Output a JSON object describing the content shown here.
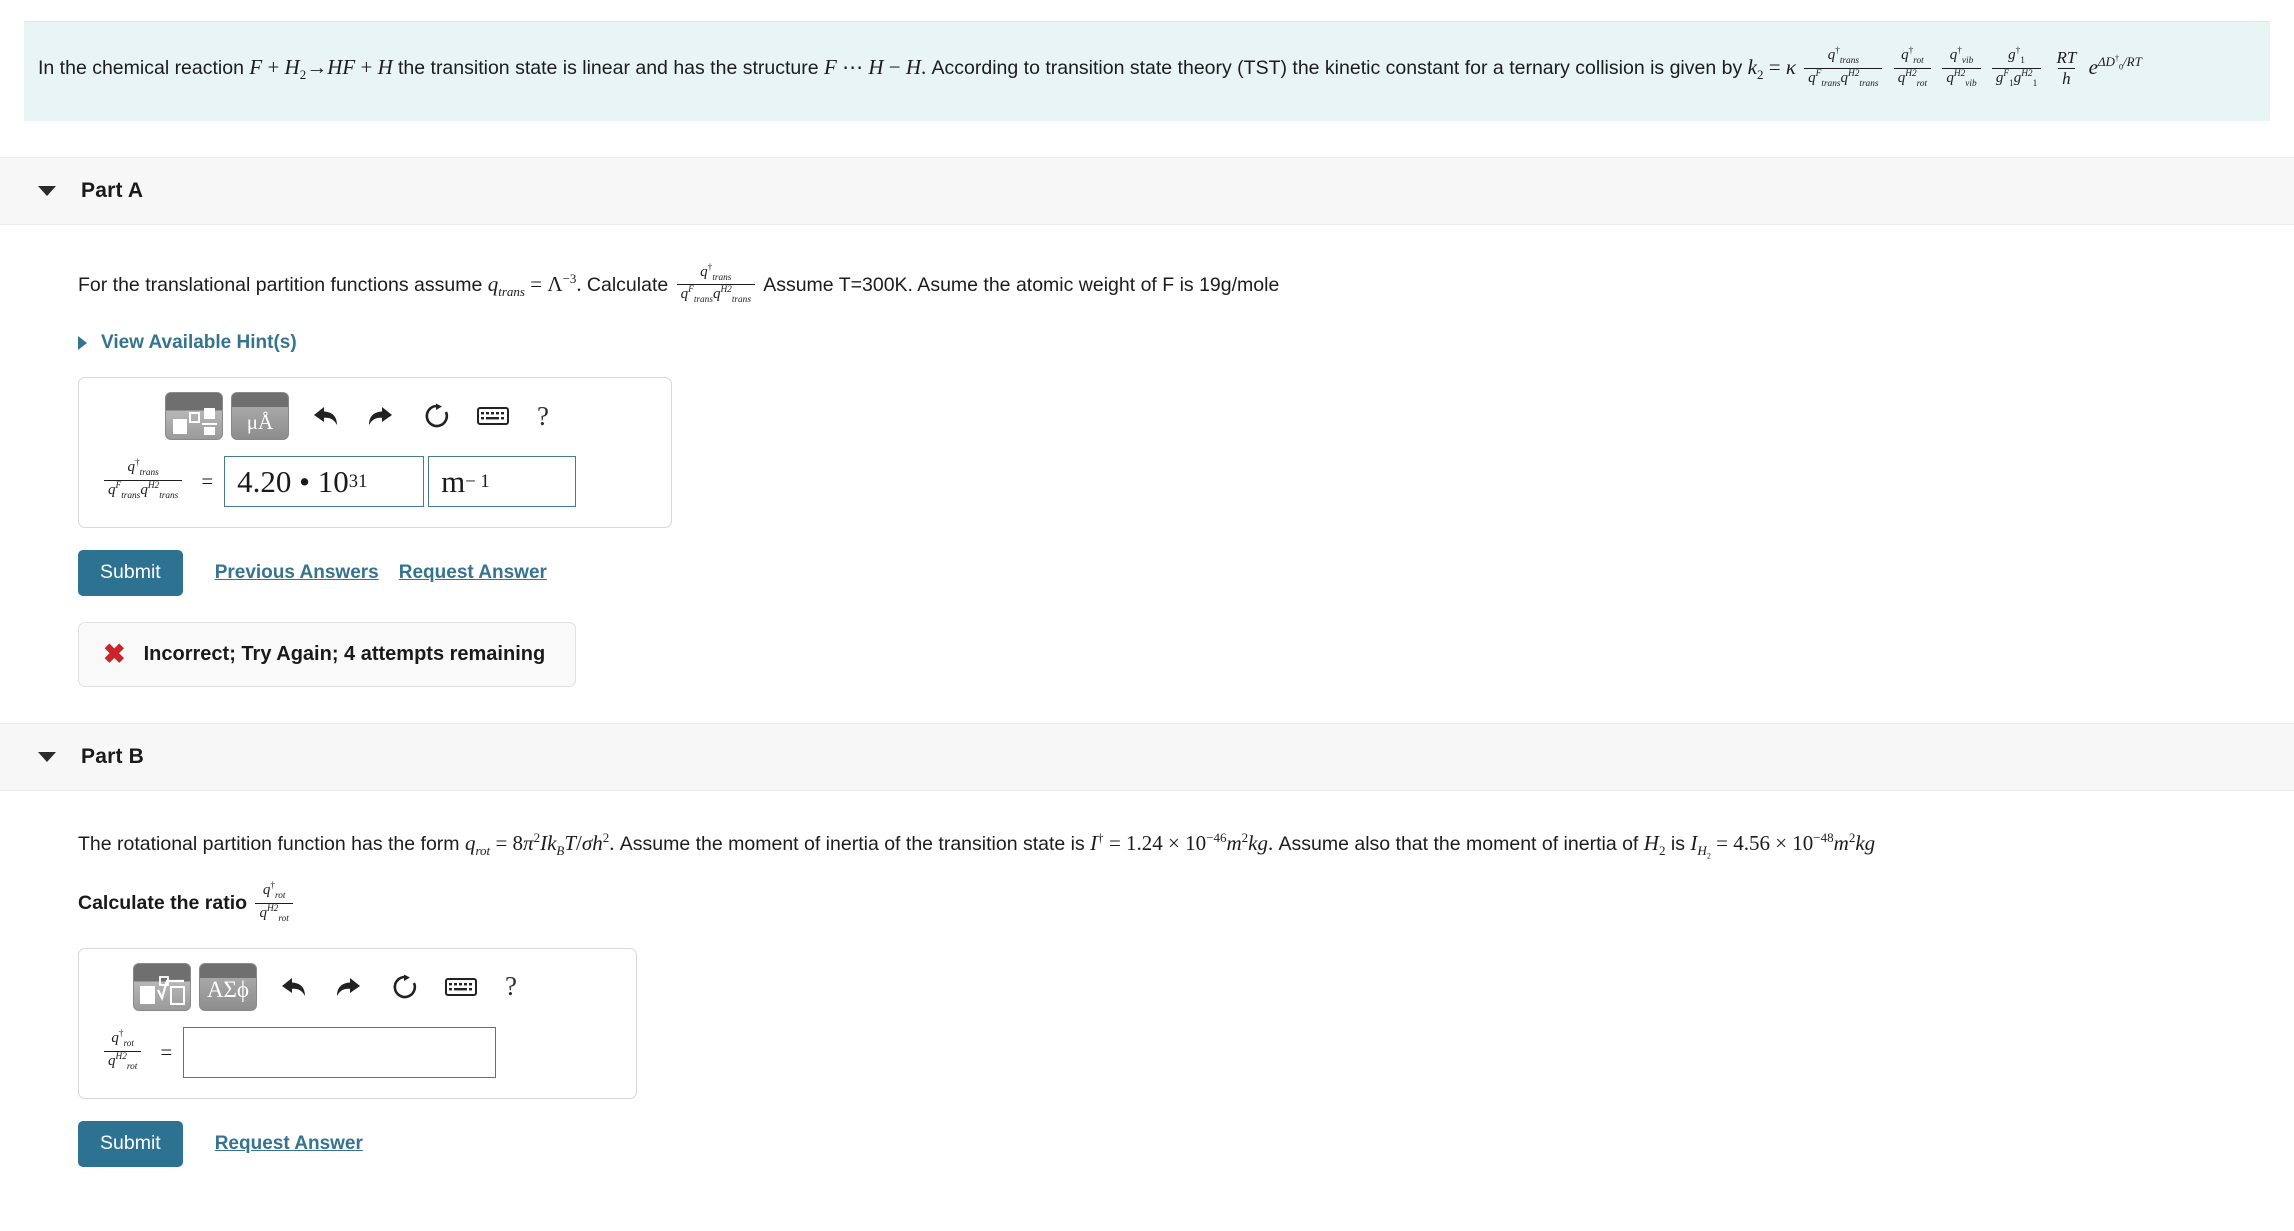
{
  "problem": {
    "intro_1": "In the chemical reaction",
    "reaction": "F + H2 → HF + H",
    "intro_2": "the transition state is linear and has the structure",
    "structure": "F ⋯ H − H.",
    "intro_3": "According to transition state theory (TST) the kinetic constant for a ternary collision is given by",
    "equation": "k2 = κ (q†trans / qᶠtrans qᴴ²trans)(q†rot / qᴴ²rot)(q†vib / qᴴ²vib)(g†1 / gᶠ1 gᴴ²1)(RT/h) e^{ΔD†₀/RT}",
    "k_symbol": "k",
    "k_sub": "2",
    "kappa": "κ",
    "exp_base": "e",
    "exp_power": "ΔD†0/RT"
  },
  "parts": [
    {
      "id": "part-a",
      "title": "Part A",
      "prompt_1": "For the translational partition functions assume",
      "prompt_eq": "qtrans = Λ⁻³.",
      "prompt_2": "Calculate",
      "prompt_ratio": "q†trans / (qᶠtrans qᴴ²trans)",
      "prompt_3": "Assume T=300K. Asume the atomic weight of F is 19g/mole",
      "hint_label": "View Available Hint(s)",
      "toolbar": {
        "template_icon": "math-template-icon",
        "units_label": "μÅ",
        "undo_icon": "undo-arrow-icon",
        "redo_icon": "redo-arrow-icon",
        "reset_icon": "reset-circle-icon",
        "keyboard_icon": "keyboard-icon",
        "help_label": "?"
      },
      "answer": {
        "label_num": "q†trans",
        "label_den": "qᶠtrans qᴴ²trans",
        "equals": "=",
        "value": "4.20 • 10",
        "value_exponent": "31",
        "units": "m",
        "units_exponent": "− 1"
      },
      "submit_label": "Submit",
      "links": [
        "Previous Answers",
        "Request Answer"
      ],
      "feedback": {
        "icon": "red-x-icon",
        "text": "Incorrect; Try Again; 4 attempts remaining"
      }
    },
    {
      "id": "part-b",
      "title": "Part B",
      "prompt_1": "The rotational partition function has the form",
      "prompt_eq": "qrot = 8π²IkBT/σh².",
      "prompt_2": "Assume the moment of inertia of the transition state is",
      "prompt_eq2": "I† = 1.24 × 10⁻⁴⁶ m²kg.",
      "prompt_3": "Assume also that the moment of inertia of",
      "prompt_h2": "H2",
      "prompt_4": "is",
      "prompt_eq3": "IH2 = 4.56 × 10⁻⁴⁸ m²kg",
      "calc_label": "Calculate the ratio",
      "calc_ratio_num": "q†rot",
      "calc_ratio_den": "qᴴ²rot",
      "toolbar": {
        "template_icon": "nth-root-template-icon",
        "symbols_label": "ΑΣϕ",
        "undo_icon": "undo-arrow-icon",
        "redo_icon": "redo-arrow-icon",
        "reset_icon": "reset-circle-icon",
        "keyboard_icon": "keyboard-icon",
        "help_label": "?"
      },
      "answer": {
        "label_num": "q†rot",
        "label_den": "qᴴ²rot",
        "equals": "=",
        "value": "",
        "placeholder": ""
      },
      "submit_label": "Submit",
      "links": [
        "Request Answer"
      ]
    }
  ],
  "colors": {
    "banner_bg": "#e9f4f4",
    "link": "#35748f",
    "submit": "#2e7292",
    "error": "#cc2229",
    "input_border": "#4a7b94"
  }
}
